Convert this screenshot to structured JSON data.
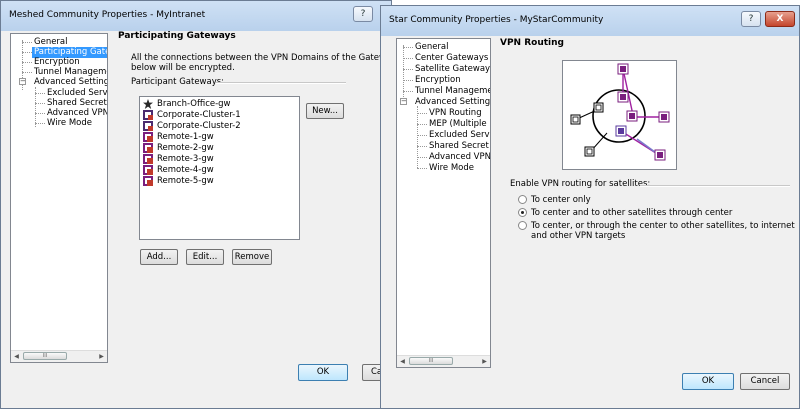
{
  "meshed": {
    "title": "Meshed Community Properties - MyIntranet",
    "help_glyph": "?",
    "close_glyph": "X",
    "tree": [
      "General",
      "Participating Gateways",
      "Encryption",
      "Tunnel Management",
      "Advanced Settings",
      "Excluded Services",
      "Shared Secret",
      "Advanced VPN Pr",
      "Wire Mode"
    ],
    "scroll_thumb": "III",
    "heading": "Participating Gateways",
    "description_line1": "All the connections between the VPN Domains of the Gateways",
    "description_line2": "below will be encrypted.",
    "participants_label": "Participant Gateways:",
    "gateways": [
      "Branch-Office-gw",
      "Corporate-Cluster-1",
      "Corporate-Cluster-2",
      "Remote-1-gw",
      "Remote-2-gw",
      "Remote-3-gw",
      "Remote-4-gw",
      "Remote-5-gw"
    ],
    "new_button": "New...",
    "add_button": "Add...",
    "edit_button": "Edit...",
    "remove_button": "Remove",
    "ok_button": "OK",
    "cancel_button": "Canc"
  },
  "star": {
    "title": "Star Community Properties - MyStarCommunity",
    "help_glyph": "?",
    "close_glyph": "X",
    "tree": [
      "General",
      "Center Gateways",
      "Satellite Gateways",
      "Encryption",
      "Tunnel Management",
      "Advanced Settings",
      "VPN Routing",
      "MEP (Multiple Entry",
      "Excluded Services",
      "Shared Secret",
      "Advanced VPN Pr",
      "Wire Mode"
    ],
    "scroll_thumb": "III",
    "heading": "VPN Routing",
    "routing_label": "Enable VPN routing for satellites:",
    "options": [
      {
        "line1": "To center only",
        "line2": "",
        "selected": false
      },
      {
        "line1": "To center and to other satellites through center",
        "line2": "",
        "selected": true
      },
      {
        "line1": "To center, or through the center to other satellites, to internet",
        "line2": "and other VPN targets",
        "selected": false
      }
    ],
    "ok_button": "OK",
    "cancel_button": "Cancel"
  }
}
